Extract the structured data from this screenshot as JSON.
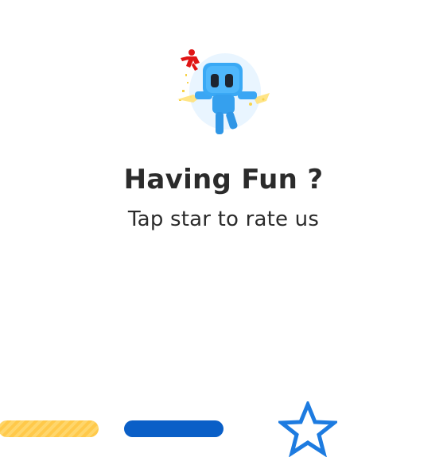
{
  "dialog": {
    "title": "Having Fun ?",
    "subtitle": "Tap star to rate us"
  },
  "icons": {
    "mascot": "blue-robot-character-icon",
    "rate_star": "star-outline-icon"
  },
  "colors": {
    "background": "#ffffff",
    "text": "#2b2b2b",
    "star_outline": "#1d7be0",
    "bar_blue": "#0a5fc7",
    "bar_yellow": "#ffd66b"
  }
}
